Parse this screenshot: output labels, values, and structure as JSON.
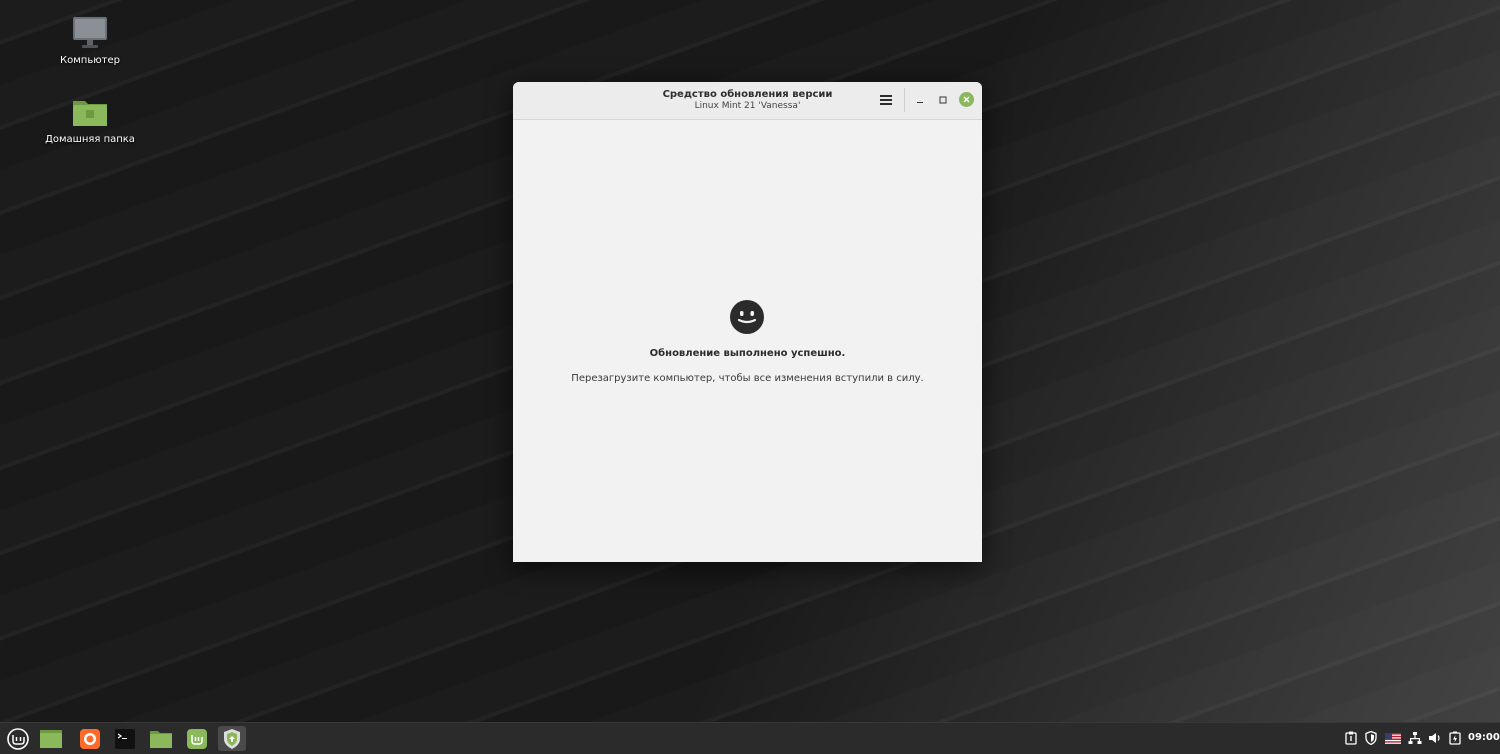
{
  "desktop": {
    "icons": [
      {
        "label": "Компьютер"
      },
      {
        "label": "Домашняя папка"
      }
    ]
  },
  "window": {
    "title": "Средство обновления версии",
    "subtitle": "Linux Mint 21 'Vanessa'",
    "success_title": "Обновление выполнено успешно.",
    "success_message": "Перезагрузите компьютер, чтобы все изменения вступили в силу."
  },
  "taskbar": {
    "apps": [
      {
        "icon": "mint-menu-icon"
      },
      {
        "icon": "show-desktop-icon"
      },
      {
        "icon": "firefox-icon"
      },
      {
        "icon": "terminal-icon"
      },
      {
        "icon": "file-manager-icon"
      },
      {
        "icon": "mintinstall-icon"
      },
      {
        "icon": "upgrade-tool-icon"
      }
    ],
    "clock": "09:00"
  },
  "colors": {
    "accent": "#8ab85a",
    "panel": "#2b2b2b"
  }
}
